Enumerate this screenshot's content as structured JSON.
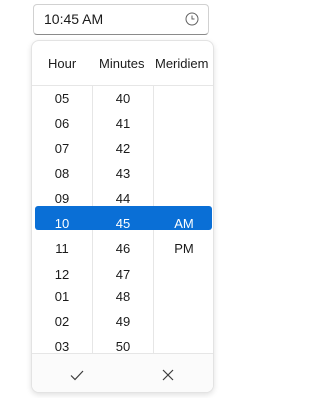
{
  "input": {
    "value": "10:45 AM",
    "icon": "clock-icon"
  },
  "picker": {
    "headers": [
      "Hour",
      "Minutes",
      "Meridiem"
    ],
    "hours": [
      "05",
      "06",
      "07",
      "08",
      "09",
      "10",
      "11",
      "12",
      "01",
      "02",
      "03"
    ],
    "minutes": [
      "40",
      "41",
      "42",
      "43",
      "44",
      "45",
      "46",
      "47",
      "48",
      "49",
      "50"
    ],
    "meridiem": [
      "AM",
      "PM"
    ],
    "selected": {
      "hour": "10",
      "minute": "45",
      "meridiem": "AM"
    },
    "accent": "#0a6fd6"
  },
  "footer": {
    "accept_icon": "check-icon",
    "cancel_icon": "close-icon"
  }
}
